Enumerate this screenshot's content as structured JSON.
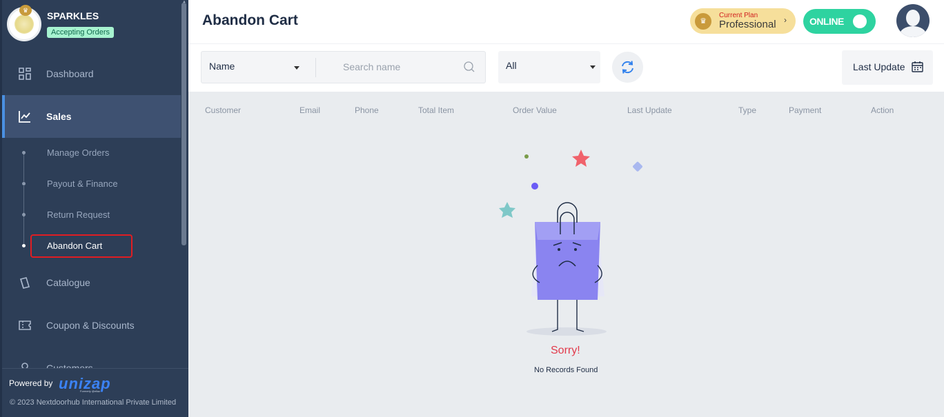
{
  "sidebar": {
    "store_name": "SPARKLES",
    "store_status": "Accepting Orders",
    "items": [
      {
        "label": "Dashboard",
        "icon": "dashboard-icon"
      },
      {
        "label": "Sales",
        "icon": "sales-chart-icon"
      },
      {
        "label": "Catalogue",
        "icon": "catalogue-icon"
      },
      {
        "label": "Coupon & Discounts",
        "icon": "coupon-icon"
      },
      {
        "label": "Customers",
        "icon": "customers-icon"
      }
    ],
    "sales_sub": [
      "Manage Orders",
      "Payout & Finance",
      "Return Request",
      "Abandon Cart"
    ],
    "footer": {
      "powered_by": "Powered by",
      "brand": "unizap",
      "brand_sub": "Formerly @ellaz",
      "copyright": "© 2023 Nextdoorhub International Private Limited"
    }
  },
  "header": {
    "title": "Abandon Cart",
    "plan_caption": "Current Plan",
    "plan_name": "Professional",
    "online_label": "ONLINE"
  },
  "toolbar": {
    "filter_field": "Name",
    "search_placeholder": "Search name",
    "status_filter": "All",
    "sort_label": "Last Update"
  },
  "table": {
    "columns": [
      "Customer",
      "Email",
      "Phone",
      "Total Item",
      "Order Value",
      "Last Update",
      "Type",
      "Payment",
      "Action"
    ]
  },
  "empty_state": {
    "title": "Sorry!",
    "message": "No Records Found"
  },
  "colors": {
    "sidebar_bg": "#2d3e57",
    "accent": "#4a90e2",
    "online": "#2ed3a0",
    "sorry": "#e23a4b"
  }
}
